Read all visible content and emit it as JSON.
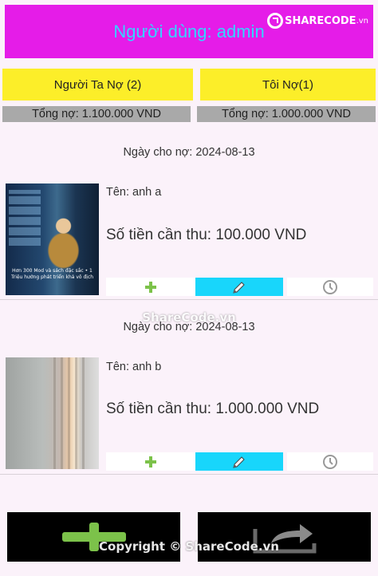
{
  "header": {
    "title": "Người dùng: admin",
    "logo": "SHARECODE",
    "logo_suffix": ".vn"
  },
  "tabs": [
    {
      "label": "Người Ta Nợ (2)",
      "total": "Tổng nợ: 1.100.000 VND"
    },
    {
      "label": "Tôi Nợ(1)",
      "total": "Tổng nợ: 1.000.000 VND"
    }
  ],
  "records": [
    {
      "date": "Ngày cho nợ: 2024-08-13",
      "name": "Tên: anh a",
      "amount": "Số tiền cần thu: 100.000 VND",
      "image_caption": "Hơn 300 Mod và sách đặc sắc • 1 Triệu hướng phát triển khả vô địch",
      "image": "game-poster"
    },
    {
      "date": "Ngày cho nợ: 2024-08-13",
      "name": "Tên: anh b",
      "amount": "Số tiền cần thu: 1.000.000 VND",
      "image": "curtain-photo"
    }
  ],
  "actions": {
    "add_icon": "plus-icon",
    "edit_icon": "pencil-icon",
    "history_icon": "clock-icon"
  },
  "bottom_buttons": [
    {
      "icon": "plus-icon"
    },
    {
      "icon": "share-arrow-icon"
    }
  ],
  "watermarks": {
    "middle": "ShareCode.vn",
    "footer": "Copyright © ShareCode.vn"
  },
  "colors": {
    "header_bg": "#e51ce8",
    "header_text": "#33d6ff",
    "tab_bg": "#fcee29",
    "total_bg": "#a9a9a9",
    "edit_bg": "#18d6fb",
    "plus": "#7cc24a"
  }
}
